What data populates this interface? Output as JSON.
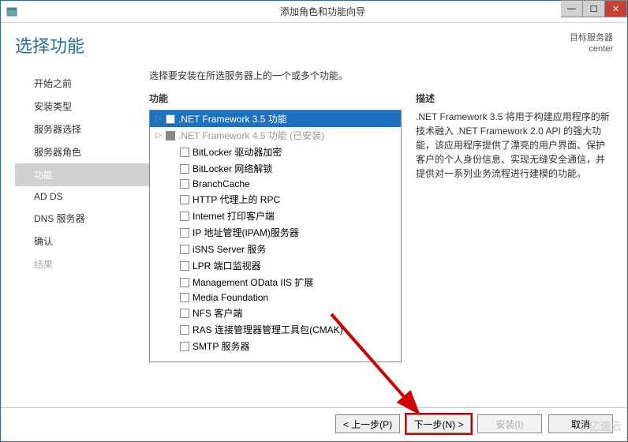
{
  "window": {
    "title": "添加角色和功能向导",
    "minimize_icon": "—",
    "maximize_icon": "☐",
    "close_icon": "✕"
  },
  "header": {
    "page_title": "选择功能",
    "dest_label": "目标服务器",
    "dest_value": "center"
  },
  "sidebar": {
    "items": [
      {
        "label": "开始之前"
      },
      {
        "label": "安装类型"
      },
      {
        "label": "服务器选择"
      },
      {
        "label": "服务器角色"
      },
      {
        "label": "功能",
        "selected": true
      },
      {
        "label": "AD DS"
      },
      {
        "label": "DNS 服务器"
      },
      {
        "label": "确认"
      },
      {
        "label": "结果",
        "disabled": true
      }
    ]
  },
  "main": {
    "instruction": "选择要安装在所选服务器上的一个或多个功能。",
    "features_label": "功能",
    "description_label": "描述",
    "features": [
      {
        "label": ".NET Framework 3.5 功能",
        "expandable": true,
        "selected": true
      },
      {
        "label": ".NET Framework 4.5 功能 (已安装)",
        "expandable": true,
        "installed": true
      },
      {
        "label": "BitLocker 驱动器加密"
      },
      {
        "label": "BitLocker 网络解锁"
      },
      {
        "label": "BranchCache"
      },
      {
        "label": "HTTP 代理上的 RPC"
      },
      {
        "label": "Internet 打印客户端"
      },
      {
        "label": "IP 地址管理(IPAM)服务器"
      },
      {
        "label": "iSNS Server 服务"
      },
      {
        "label": "LPR 端口监视器"
      },
      {
        "label": "Management OData IIS 扩展"
      },
      {
        "label": "Media Foundation"
      },
      {
        "label": "NFS 客户端"
      },
      {
        "label": "RAS 连接管理器管理工具包(CMAK)"
      },
      {
        "label": "SMTP 服务器"
      }
    ],
    "description": ".NET Framework 3.5 将用于构建应用程序的新技术融入 .NET Framework 2.0 API 的强大功能，该应用程序提供了漂亮的用户界面、保护客户的个人身份信息、实现无缝安全通信，并提供对一系列业务流程进行建模的功能。"
  },
  "footer": {
    "previous": "< 上一步(P)",
    "next": "下一步(N) >",
    "install": "安装(I)",
    "cancel": "取消"
  },
  "watermark": "亿速云"
}
